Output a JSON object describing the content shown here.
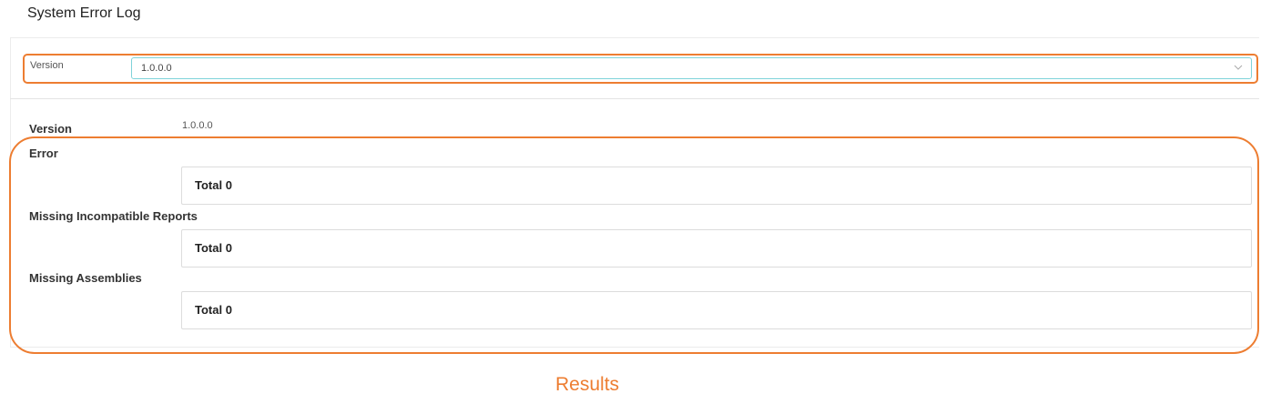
{
  "page": {
    "title": "System Error Log"
  },
  "filter": {
    "label": "Version",
    "selected": "1.0.0.0",
    "icon": "chevron-down-icon"
  },
  "results": {
    "version_label": "Version",
    "version_value": "1.0.0.0",
    "sections": [
      {
        "label": "Error",
        "total": "Total 0"
      },
      {
        "label": "Missing Incompatible Reports",
        "total": "Total 0"
      },
      {
        "label": "Missing Assemblies",
        "total": "Total 0"
      }
    ]
  },
  "annotations": {
    "caption": "Results",
    "highlight_color": "#ed7d31"
  },
  "colors": {
    "select_border": "#7fd3d9",
    "box_border": "#dcdcdc"
  }
}
